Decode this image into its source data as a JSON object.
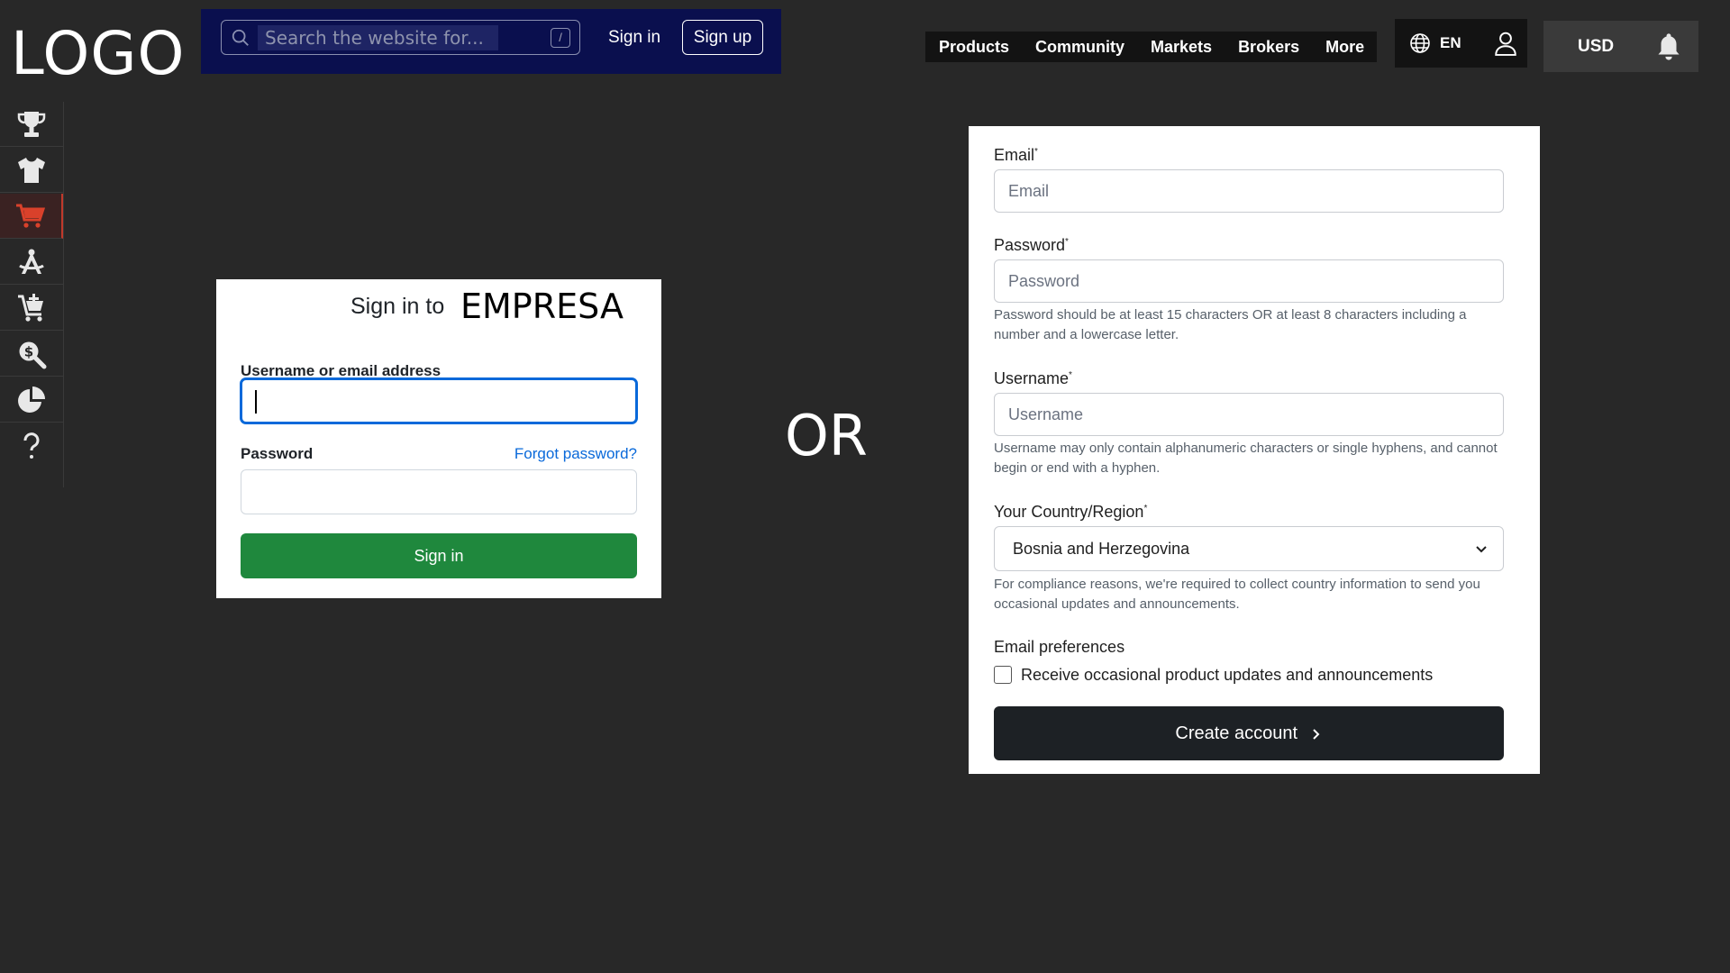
{
  "logo": "LOGO",
  "header": {
    "search_placeholder": "Search the website for...",
    "search_shortcut": "/",
    "signin_label": "Sign in",
    "signup_label": "Sign up",
    "nav": [
      "Products",
      "Community",
      "Markets",
      "Brokers",
      "More"
    ],
    "language": "EN",
    "currency": "USD"
  },
  "sidebar": {
    "items": [
      "trophy-icon",
      "tshirt-icon",
      "cart-icon",
      "tools-icon",
      "cart-plus-icon",
      "search-dollar-icon",
      "pie-chart-icon",
      "question-icon"
    ],
    "active_index": 2
  },
  "signin": {
    "title_prefix": "Sign in to",
    "title_brand": "EMPRESA",
    "username_label": "Username or email address",
    "password_label": "Password",
    "forgot_label": "Forgot password?",
    "button_label": "Sign in"
  },
  "or_label": "OR",
  "signup": {
    "email_label": "Email",
    "email_placeholder": "Email",
    "password_label": "Password",
    "password_placeholder": "Password",
    "password_help": "Password should be at least 15 characters OR at least 8 characters including a number and a lowercase letter.",
    "username_label": "Username",
    "username_placeholder": "Username",
    "username_help": "Username may only contain alphanumeric characters or single hyphens, and cannot begin or end with a hyphen.",
    "country_label": "Your Country/Region",
    "country_value": "Bosnia and Herzegovina",
    "country_help": "For compliance reasons, we're required to collect country information to send you occasional updates and announcements.",
    "prefs_label": "Email preferences",
    "prefs_checkbox_label": "Receive occasional product updates and announcements",
    "button_label": "Create account",
    "required_mark": "*"
  },
  "colors": {
    "background": "#282828",
    "header_left": "#0a0f4e",
    "signin_button": "#1f883d",
    "create_button": "#1d2125",
    "active_icon": "#d9412b"
  }
}
